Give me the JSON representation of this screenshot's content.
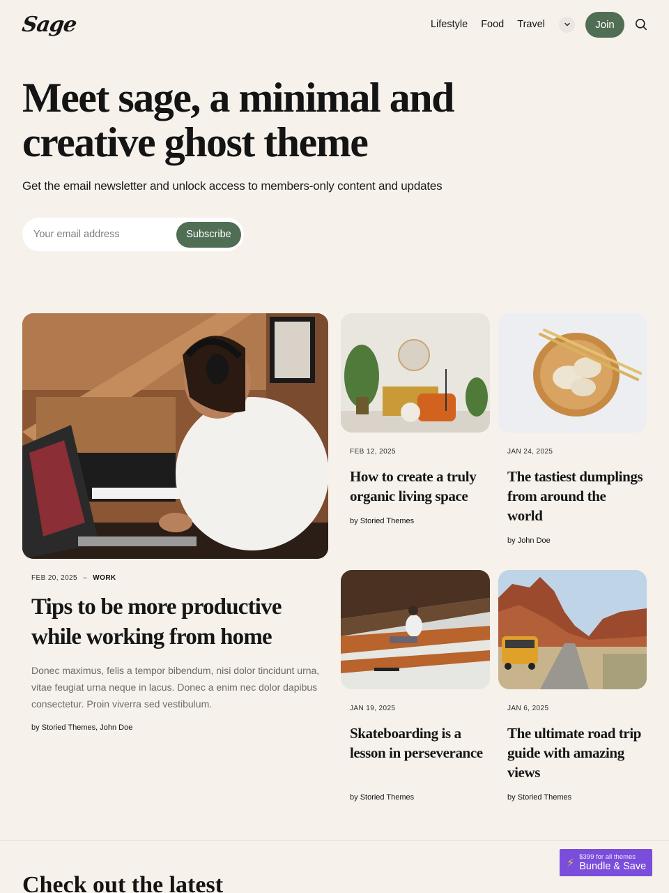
{
  "header": {
    "logo": "Sage",
    "nav": [
      "Lifestyle",
      "Food",
      "Travel"
    ],
    "join_label": "Join"
  },
  "hero": {
    "title": "Meet sage, a minimal and creative ghost theme",
    "subtitle": "Get the email newsletter and unlock access to members-only content and updates",
    "email_placeholder": "Your email address",
    "subscribe_label": "Subscribe"
  },
  "featured": {
    "date": "FEB 20, 2025",
    "separator": "–",
    "tag": "WORK",
    "title": "Tips to be more productive while working from home",
    "excerpt": "Donec maximus, felis a tempor bibendum, nisi dolor tincidunt urna, vitae feugiat urna neque in lacus. Donec a enim nec dolor dapibus consectetur. Proin viverra sed vestibulum.",
    "by": "by",
    "authors": "Storied Themes, John Doe"
  },
  "posts": [
    {
      "date": "FEB 12, 2025",
      "title": "How to create a truly organic living space",
      "by": "by",
      "author": "Storied Themes"
    },
    {
      "date": "JAN 24, 2025",
      "title": "The tastiest dumplings from around the world",
      "by": "by",
      "author": "John Doe"
    },
    {
      "date": "JAN 19, 2025",
      "title": "Skateboarding is a lesson in perseverance",
      "by": "by",
      "author": "Storied Themes"
    },
    {
      "date": "JAN 6, 2025",
      "title": "The ultimate road trip guide with amazing views",
      "by": "by",
      "author": "Storied Themes"
    }
  ],
  "latest": {
    "title": "Check out the latest"
  },
  "promo": {
    "price": "$399 for all themes",
    "label": "Bundle & Save"
  },
  "icons": {
    "nav_more": "chevron-down-icon",
    "search": "search-icon",
    "promo": "bolt-icon"
  },
  "colors": {
    "accent": "#4f6e53",
    "background": "#f6f1eb",
    "promo": "#7b4ddb"
  }
}
